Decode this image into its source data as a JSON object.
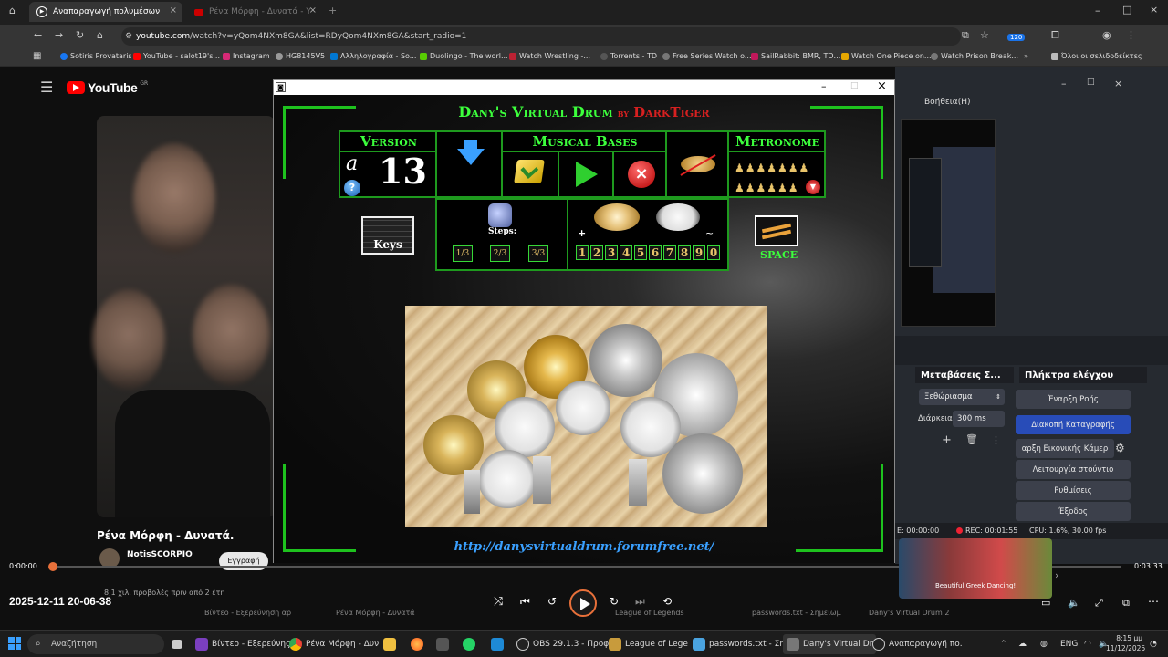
{
  "browser": {
    "tabs": [
      {
        "label": "Αναπαραγωγή πολυμέσων",
        "active": true
      },
      {
        "label": "Ρένα Μόρφη - Δυνατά - Y",
        "active": false
      }
    ],
    "url_domain": "youtube.com",
    "url_rest": "/watch?v=yQom4NXm8GA&list=RDyQom4NXm8GA&start_radio=1",
    "bookmarks": [
      "Sotiris Provataris",
      "YouTube - salot19's...",
      "Instagram",
      "HG8145V5",
      "Αλληλογραφία - So...",
      "Duolingo - The worl...",
      "Watch Wrestling -...",
      "Torrents - TD",
      "Free Series Watch o...",
      "SailRabbit: BMR, TD...",
      "Watch One Piece on...",
      "Watch Prison Break..."
    ],
    "bookmarks_all": "Όλοι οι σελιδοδείκτες",
    "notification_badge": "120"
  },
  "youtube": {
    "logo": "YouTube",
    "country": "GR",
    "video_title": "Ρένα Μόρφη - Δυνατά.",
    "channel": "NotisSCORPIO",
    "subscribe": "Εγγραφή",
    "views": "8,1 χιλ. προβολές  πριν από 2 έτη",
    "time_current": "0:00:00",
    "time_total": "0:03:33",
    "progress_fraction": 0.0,
    "timestamp_overlay": "2025-12-11 20-06-38"
  },
  "app": {
    "title": "Dany's Virtual Drum",
    "heading_main": "Dany's Virtual Drum",
    "heading_by": "by",
    "heading_author": "DarkTiger",
    "version_label": "Version",
    "version_letter": "a",
    "version_number": "13",
    "bases_label": "Musical Bases",
    "metronome_label": "Metronome",
    "keys_label": "Keys",
    "steps_label": "Steps:",
    "steps": [
      "1/3",
      "2/3",
      "3/3"
    ],
    "plus_sign": "+",
    "tilde_sign": "~",
    "digits": [
      "1",
      "2",
      "3",
      "4",
      "5",
      "6",
      "7",
      "8",
      "9",
      "0"
    ],
    "space_label": "SPACE",
    "url": "http://danysvirtualdrum.forumfree.net/",
    "colors": {
      "green": "#1ec21e",
      "gold": "#e9c46a",
      "red": "#d62020"
    }
  },
  "obs": {
    "menu_help": "Βοήθεια(H)",
    "transitions_title": "Μεταβάσεις Σ...",
    "controls_title": "Πλήκτρα ελέγχου",
    "transition_type": "Ξεθώριασμα",
    "duration_label": "Διάρκεια",
    "duration_value": "300 ms",
    "buttons": [
      "Έναρξη Ροής",
      "Διακοπή Καταγραφής",
      "αρξη Εικονικής Κάμερ",
      "Λειτουργία στούντιο",
      "Ρυθμίσεις",
      "Έξοδος"
    ],
    "status_live": "E: 00:00:00",
    "status_rec": "REC: 00:01:55",
    "status_cpu": "CPU: 1.6%, 30.00 fps"
  },
  "taskbar": {
    "search": "Αναζήτηση",
    "items": [
      "Βίντεο - Εξερεύνης",
      "Ρένα Μόρφη - Δυν",
      "OBS 29.1.3 - Προφί",
      "League of Lege",
      "passwords.txt - Σημ",
      "Dany's Virtual Dr",
      "Αναπαραγωγή πο."
    ],
    "thumb_row": [
      "Βίντεο - Εξερεύνηση αρ",
      "Ρένα Μόρφη - Δυνατά",
      "League of Legends",
      "passwords.txt - Σημειωμ",
      "Dany's Virtual Drum 2"
    ],
    "lang": "ENG",
    "time": "8:15 μμ",
    "date": "11/12/2025",
    "thumb_right_label": "Beautiful Greek\nDancing!"
  }
}
